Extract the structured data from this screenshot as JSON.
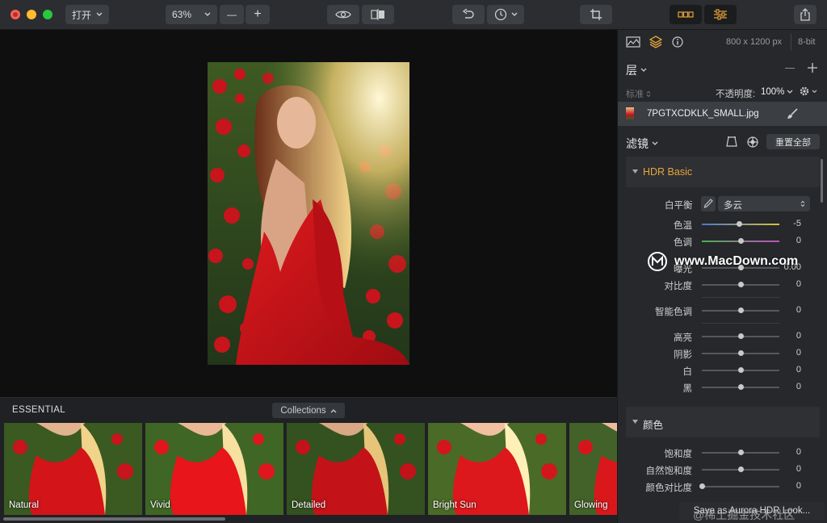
{
  "toolbar": {
    "open_label": "打开",
    "zoom_value": "63%",
    "zoom_minus": "—",
    "zoom_plus": "+"
  },
  "canvas": {
    "image_description_color": "#c0141c"
  },
  "strip": {
    "title": "ESSENTIAL",
    "collections_label": "Collections",
    "presets": [
      {
        "label": "Natural"
      },
      {
        "label": "Vivid"
      },
      {
        "label": "Detailed"
      },
      {
        "label": "Bright Sun"
      },
      {
        "label": "Glowing"
      }
    ]
  },
  "panel": {
    "image_info": "800 x 1200 px",
    "bit_depth": "8-bit",
    "layers_title": "层",
    "blend_mode": "标准",
    "opacity_label": "不透明度:",
    "opacity_value": "100%",
    "layer_name": "7PGTXCDKLK_SMALL.jpg",
    "filters_title": "滤镜",
    "reset_all": "重置全部",
    "hdr_basic": {
      "title": "HDR Basic",
      "white_balance_label": "白平衡",
      "white_balance_value": "多云",
      "sliders": [
        {
          "label": "色温",
          "value": "-5",
          "position": 0.48
        },
        {
          "label": "色调",
          "value": "0",
          "position": 0.5
        },
        {
          "label": "曝光",
          "value": "0.00",
          "position": 0.5
        },
        {
          "label": "对比度",
          "value": "0",
          "position": 0.5
        },
        {
          "label": "智能色调",
          "value": "0",
          "position": 0.5
        },
        {
          "label": "高亮",
          "value": "0",
          "position": 0.5
        },
        {
          "label": "阴影",
          "value": "0",
          "position": 0.5
        },
        {
          "label": "白",
          "value": "0",
          "position": 0.5
        },
        {
          "label": "黑",
          "value": "0",
          "position": 0.5
        }
      ]
    },
    "color": {
      "title": "颜色",
      "sliders": [
        {
          "label": "饱和度",
          "value": "0",
          "position": 0.5
        },
        {
          "label": "自然饱和度",
          "value": "0",
          "position": 0.5
        },
        {
          "label": "颜色对比度",
          "value": "0",
          "position": 0.0
        }
      ]
    },
    "save_look": "Save as Aurora HDR Look...",
    "accent": "#e8a53a"
  },
  "watermarks": {
    "site": "www.MacDown.com",
    "bottom": "@稀土掘金技术社区"
  }
}
